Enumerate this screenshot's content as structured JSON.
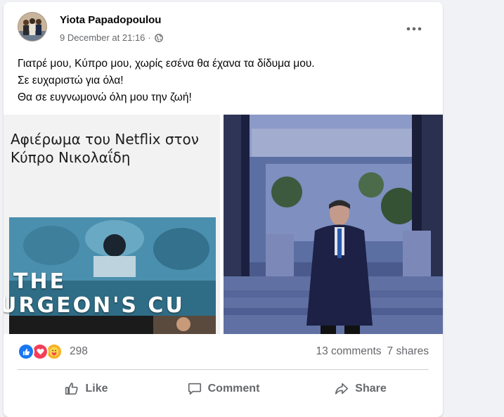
{
  "post": {
    "author": "Yiota Papadopoulou",
    "timestamp": "9 December at 21:16",
    "separator": "·",
    "privacy_icon": "globe-icon",
    "more_icon": "more-options-icon",
    "text_lines": [
      "Γιατρέ μου, Κύπρο μου, χωρίς εσένα θα έχανα τα δίδυμα μου.",
      "Σε ευχαριστώ για όλα!",
      "Θα σε ευγνωμονώ όλη μου την ζωή!"
    ],
    "media": {
      "left_title_lines": [
        "Αφιέρωμα του Netflix στον",
        "Κύπρο Νικολαΐδη"
      ],
      "left_caption_lines": [
        "THE",
        "URGEON'S CU"
      ]
    }
  },
  "stats": {
    "reaction_icons": [
      "like-icon",
      "love-icon",
      "care-icon"
    ],
    "reaction_count": "298",
    "comments": "13 comments",
    "shares": "7 shares"
  },
  "actions": {
    "like_label": "Like",
    "comment_label": "Comment",
    "share_label": "Share"
  },
  "colors": {
    "like_blue": "#1877f2",
    "love_red": "#f33e58",
    "care_yellow": "#f7b125",
    "secondary_text": "#65676b"
  }
}
